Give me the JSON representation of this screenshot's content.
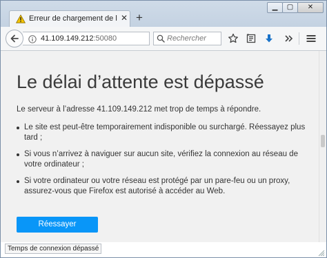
{
  "tab": {
    "title": "Erreur de chargement de la...",
    "icon": "warning-icon",
    "close_icon": "close-icon",
    "new_tab_icon": "plus-icon"
  },
  "window_controls": {
    "minimize_icon": "minimize-icon",
    "maximize_icon": "maximize-icon",
    "close_icon": "close-icon"
  },
  "navbar": {
    "back_icon": "back-arrow-icon",
    "info_icon": "info-icon",
    "url_host": "41.109.149.212",
    "url_port": ":50080",
    "reload_icon": "reload-icon",
    "search_placeholder": "Rechercher",
    "search_icon": "search-icon",
    "toolbar_icons": [
      "star-icon",
      "reading-list-icon",
      "download-icon",
      "overflow-icon",
      "hamburger-menu-icon"
    ]
  },
  "page": {
    "heading": "Le délai d’attente est dépassé",
    "lead": "Le serveur à l’adresse 41.109.149.212 met trop de temps à répondre.",
    "bullets": [
      "Le site est peut-être temporairement indisponible ou surchargé. Réessayez plus tard ;",
      "Si vous n’arrivez à naviguer sur aucun site, vérifiez la connexion au réseau de votre ordinateur ;",
      "Si votre ordinateur ou votre réseau est protégé par un pare-feu ou un proxy, assurez-vous que Firefox est autorisé à accéder au Web."
    ],
    "retry_label": "Réessayer"
  },
  "status": {
    "text": "Temps de connexion dépassé"
  },
  "colors": {
    "accent_button": "#0996f8",
    "download_arrow": "#1a73c9",
    "warning_yellow": "#f5c400"
  }
}
